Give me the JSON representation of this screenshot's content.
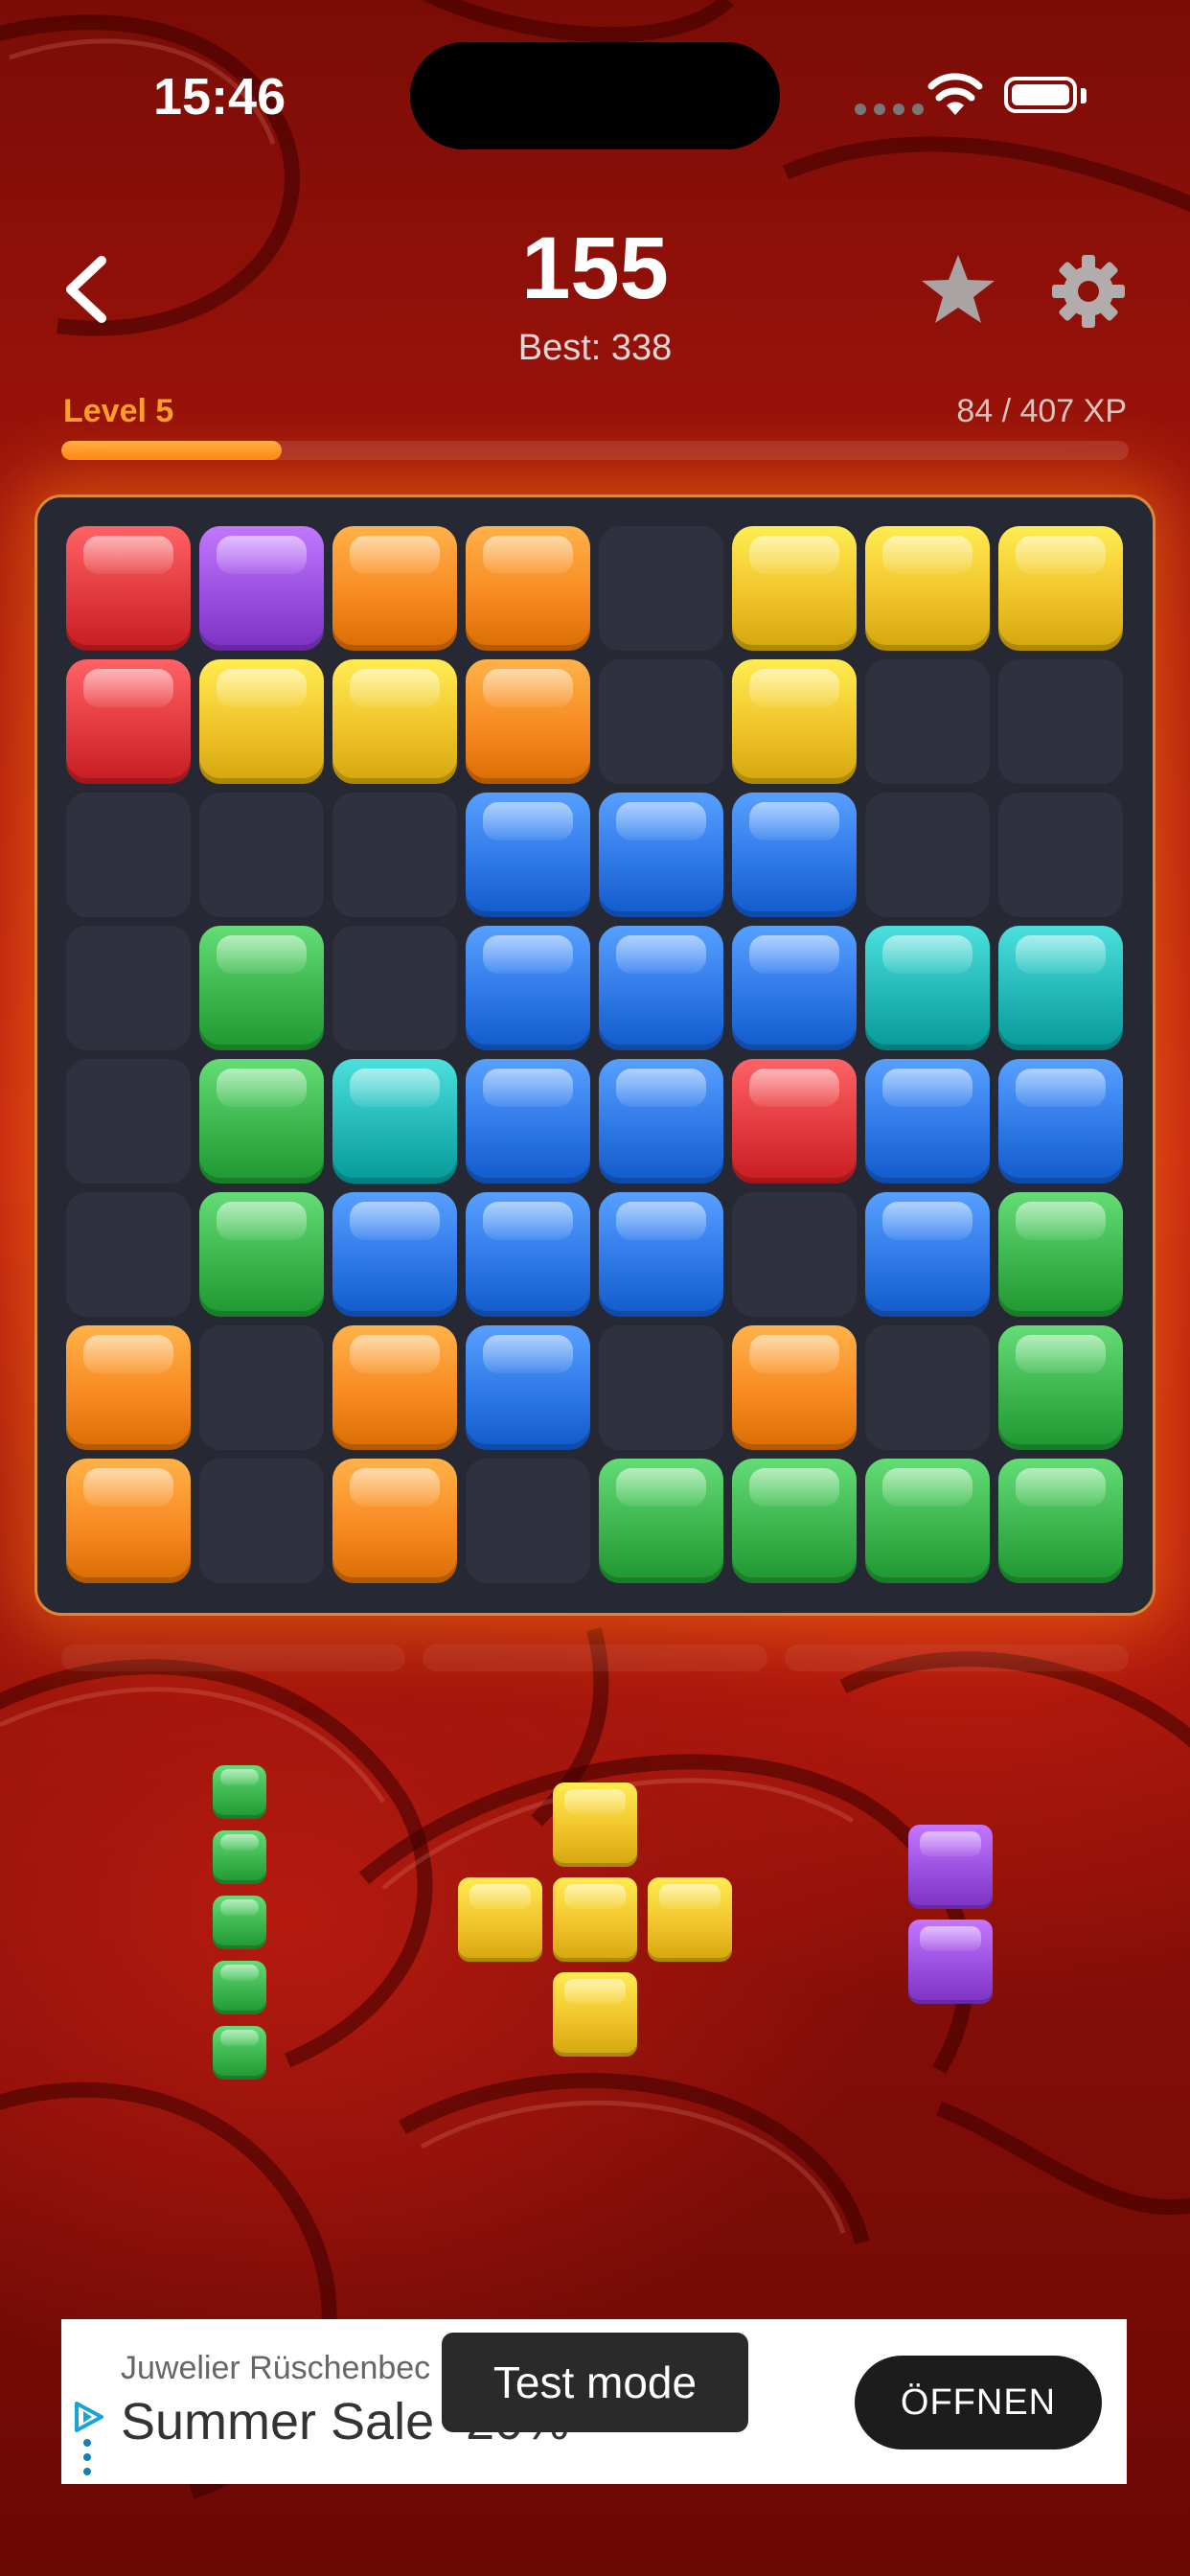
{
  "status_bar": {
    "time": "15:46"
  },
  "header": {
    "score": "155",
    "best": "Best: 338"
  },
  "progress": {
    "level": "Level 5",
    "xp": "84 / 407 XP",
    "xp_current": 84,
    "xp_total": 407
  },
  "colors": {
    "red": "#e23a3e",
    "purple": "#9b4fe0",
    "orange": "#f78a21",
    "yellow": "#f0c42a",
    "blue": "#2f78e8",
    "green": "#3cb54e",
    "cyan": "#23b8b6"
  },
  "board": {
    "rows": [
      [
        "red",
        "purple",
        "orange",
        "orange",
        null,
        "yellow",
        "yellow",
        "yellow"
      ],
      [
        "red",
        "yellow",
        "yellow",
        "orange",
        null,
        "yellow",
        null,
        null
      ],
      [
        null,
        null,
        null,
        "blue",
        "blue",
        "blue",
        null,
        null
      ],
      [
        null,
        "green",
        null,
        "blue",
        "blue",
        "blue",
        "cyan",
        "cyan"
      ],
      [
        null,
        "green",
        "cyan",
        "blue",
        "blue",
        "red",
        "blue",
        "blue"
      ],
      [
        null,
        "green",
        "blue",
        "blue",
        "blue",
        null,
        "blue",
        "green"
      ],
      [
        "orange",
        null,
        "orange",
        "blue",
        null,
        "orange",
        null,
        "green"
      ],
      [
        "orange",
        null,
        "orange",
        null,
        "green",
        "green",
        "green",
        "green"
      ]
    ]
  },
  "tray": {
    "pieces": [
      {
        "color": "green",
        "cells": [
          [
            0,
            0
          ],
          [
            1,
            0
          ],
          [
            2,
            0
          ],
          [
            3,
            0
          ],
          [
            4,
            0
          ]
        ]
      },
      {
        "color": "yellow",
        "cells": [
          [
            0,
            1
          ],
          [
            1,
            0
          ],
          [
            1,
            1
          ],
          [
            1,
            2
          ],
          [
            2,
            1
          ]
        ]
      },
      {
        "color": "purple",
        "cells": [
          [
            0,
            0
          ],
          [
            1,
            0
          ]
        ]
      }
    ]
  },
  "ad": {
    "advertiser": "Juwelier Rüschenbec",
    "headline": "Summer Sale -20%",
    "cta": "ÖFFNEN"
  },
  "toast": {
    "text": "Test mode"
  }
}
